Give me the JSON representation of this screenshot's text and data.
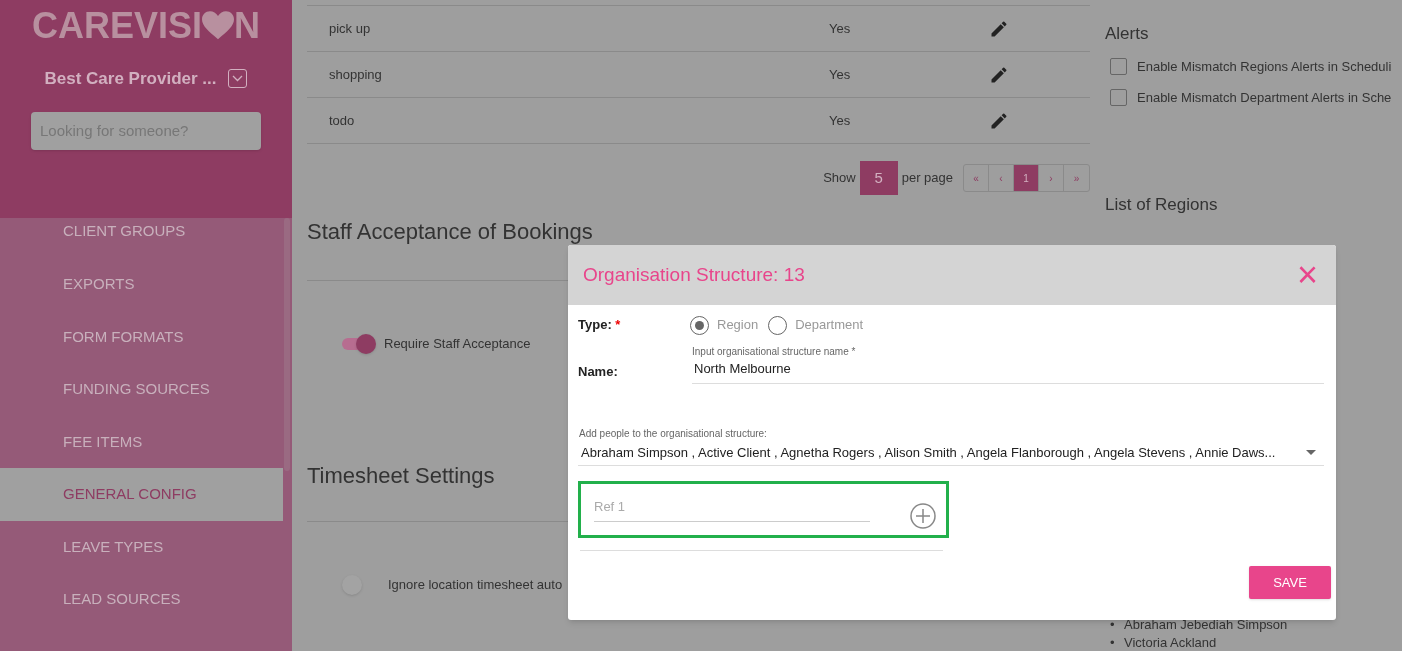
{
  "sidebar": {
    "logo": {
      "text_start": "CAREVISI",
      "text_end": "N"
    },
    "provider": "Best Care Provider ...",
    "search": {
      "placeholder": "Looking for someone?"
    },
    "items": [
      {
        "label": "CLIENT GROUPS",
        "selected": false
      },
      {
        "label": "EXPORTS",
        "selected": false
      },
      {
        "label": "FORM FORMATS",
        "selected": false
      },
      {
        "label": "FUNDING SOURCES",
        "selected": false
      },
      {
        "label": "FEE ITEMS",
        "selected": false
      },
      {
        "label": "GENERAL CONFIG",
        "selected": true
      },
      {
        "label": "LEAVE TYPES",
        "selected": false
      },
      {
        "label": "LEAD SOURCES",
        "selected": false
      }
    ]
  },
  "table": {
    "rows": [
      {
        "name": "pick up",
        "value": "Yes"
      },
      {
        "name": "shopping",
        "value": "Yes"
      },
      {
        "name": "todo",
        "value": "Yes"
      }
    ]
  },
  "pagination": {
    "show_label": "Show",
    "per_page": "5",
    "per_page_label": "per page",
    "pages": [
      {
        "label": "«",
        "selected": false
      },
      {
        "label": "‹",
        "selected": false
      },
      {
        "label": "1",
        "selected": true
      },
      {
        "label": "›",
        "selected": false
      },
      {
        "label": "»",
        "selected": false
      }
    ]
  },
  "sections": [
    {
      "title": "Staff Acceptance of Bookings",
      "toggle": {
        "label": "Require Staff Acceptance",
        "on": true
      }
    },
    {
      "title": "Timesheet Settings",
      "toggle": {
        "label": "Ignore location timesheet auto",
        "on": false
      }
    }
  ],
  "right_panel": {
    "alerts_title": "Alerts",
    "alerts": [
      {
        "label": "Enable Mismatch Regions Alerts in Scheduli",
        "checked": false
      },
      {
        "label": "Enable Mismatch Department Alerts in Sche",
        "checked": false
      }
    ],
    "regions_title": "List of Regions",
    "people": [
      {
        "bullet": "•",
        "name": "Abraham Jebediah Simpson"
      },
      {
        "bullet": "•",
        "name": "Victoria Ackland"
      }
    ]
  },
  "modal": {
    "title": "Organisation Structure: 13",
    "close": "×",
    "type_label": "Type:",
    "required_mark": "*",
    "types": [
      {
        "label": "Region",
        "selected": true
      },
      {
        "label": "Department",
        "selected": false
      }
    ],
    "name_label": "Name:",
    "name_field": {
      "label": "Input organisational structure name *",
      "value": "North Melbourne"
    },
    "people_field": {
      "label": "Add people to the organisational structure:",
      "value": "Abraham Simpson , Active Client , Agnetha Rogers , Alison Smith , Angela Flanborough , Angela Stevens , Annie Daws..."
    },
    "ref_field": {
      "placeholder": "Ref 1"
    },
    "save": "SAVE"
  }
}
